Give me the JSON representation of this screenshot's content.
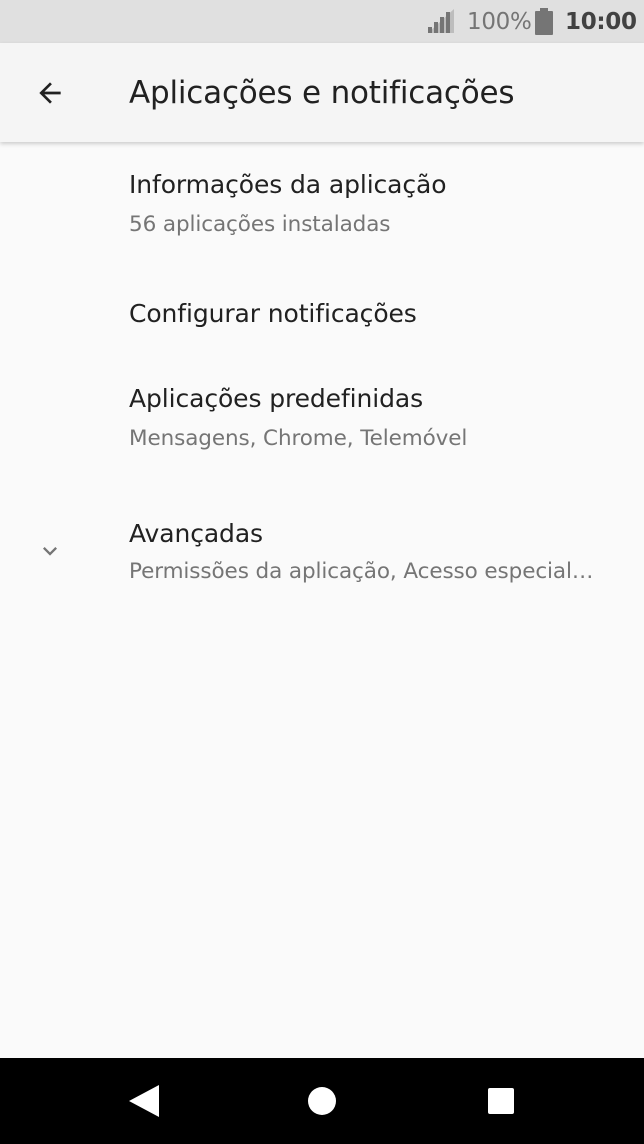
{
  "status_bar": {
    "battery_percent": "100%",
    "time": "10:00",
    "icons": [
      "signal-icon",
      "battery-icon"
    ]
  },
  "app_bar": {
    "title": "Aplicações e notificações",
    "back_icon": "arrow-back-icon"
  },
  "settings": {
    "items": [
      {
        "title": "Informações da aplicação",
        "subtitle": "56 aplicações instaladas"
      },
      {
        "title": "Configurar notificações",
        "subtitle": ""
      },
      {
        "title": "Aplicações predefinidas",
        "subtitle": "Mensagens, Chrome, Telemóvel"
      },
      {
        "title": "Avançadas",
        "subtitle": "Permissões da aplicação, Acesso especial…",
        "icon": "chevron-down-icon"
      }
    ]
  },
  "nav_bar": {
    "icons": [
      "back-triangle-icon",
      "home-circle-icon",
      "recents-square-icon"
    ]
  },
  "colors": {
    "status_bar_bg": "#e0e0e0",
    "app_bar_bg": "#f5f5f5",
    "background": "#fafafa",
    "primary_text": "#212121",
    "secondary_text": "#757575",
    "nav_bar_bg": "#000000"
  }
}
